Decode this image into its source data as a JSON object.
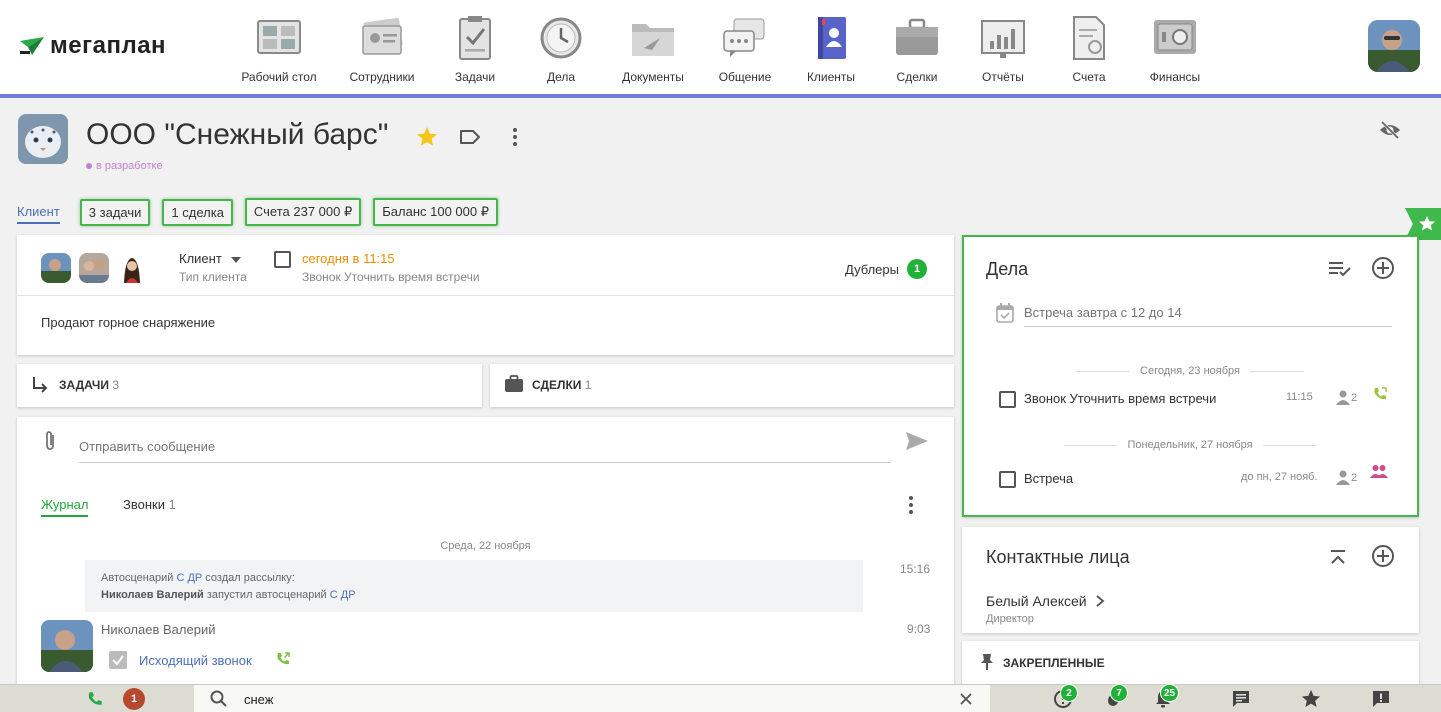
{
  "app": {
    "logo_text": "мегаплан"
  },
  "nav": [
    {
      "label": "Рабочий стол",
      "icon": "desktop-icon"
    },
    {
      "label": "Сотрудники",
      "icon": "employees-icon"
    },
    {
      "label": "Задачи",
      "icon": "tasks-icon"
    },
    {
      "label": "Дела",
      "icon": "clock-icon"
    },
    {
      "label": "Документы",
      "icon": "folder-icon"
    },
    {
      "label": "Общение",
      "icon": "chat-icon"
    },
    {
      "label": "Клиенты",
      "icon": "clients-book-icon",
      "active": true
    },
    {
      "label": "Сделки",
      "icon": "briefcase-icon"
    },
    {
      "label": "Отчёты",
      "icon": "report-icon"
    },
    {
      "label": "Счета",
      "icon": "invoice-icon"
    },
    {
      "label": "Финансы",
      "icon": "safe-icon"
    }
  ],
  "company": {
    "title": "ООО \"Снежный барс\"",
    "status": "в разработке"
  },
  "tabs": {
    "client": "Клиент",
    "pills": [
      "3 задачи",
      "1 сделка",
      "Счета 237 000 ₽",
      "Баланс 100 000 ₽"
    ]
  },
  "client_card": {
    "type_value": "Клиент",
    "type_label": "Тип клиента",
    "reminder_time": "сегодня в 11:15",
    "reminder_text": "Звонок Уточнить время встречи",
    "duplicates_label": "Дублеры",
    "duplicates_count": "1",
    "description": "Продают горное снаряжение"
  },
  "tasks_section": {
    "label": "ЗАДАЧИ",
    "count": "3"
  },
  "deals_section": {
    "label": "СДЕЛКИ",
    "count": "1"
  },
  "feed": {
    "message_placeholder": "Отправить сообщение",
    "tab_journal": "Журнал",
    "tab_calls": "Звонки",
    "tab_calls_count": "1",
    "date_header": "Среда, 22 ноября",
    "entry1": {
      "line1_prefix": "Автосценарий",
      "line1_link": "С ДР",
      "line1_suffix": "создал рассылку:",
      "line2_author": "Николаев Валерий",
      "line2_mid": "запустил автосценарий",
      "line2_link": "С ДР",
      "time": "15:16"
    },
    "entry2": {
      "author": "Николаев Валерий",
      "time": "9:03",
      "call_label": "Исходящий звонок"
    }
  },
  "dela": {
    "title": "Дела",
    "new_placeholder": "Встреча завтра с 12 до 14",
    "groups": [
      {
        "date": "Сегодня, 23 ноября",
        "item": "Звонок Уточнить время встречи",
        "time": "11:15",
        "participants": "2"
      },
      {
        "date": "Понедельник, 27 ноября",
        "item": "Встреча",
        "time": "до пн, 27 нояб.",
        "participants": "2"
      }
    ]
  },
  "contacts": {
    "title": "Контактные лица",
    "name": "Белый Алексей",
    "role": "Директор"
  },
  "pinned": {
    "title": "ЗАКРЕПЛЕННЫЕ"
  },
  "bottombar": {
    "calls_badge": "1",
    "search_value": "снеж",
    "alerts_badge": "2",
    "hot_badge": "7",
    "notifications_badge": "25"
  },
  "colors": {
    "accent": "#4c6fb8",
    "green": "#45b54c",
    "orange": "#f08c00",
    "header_line": "#6f7cd8"
  }
}
